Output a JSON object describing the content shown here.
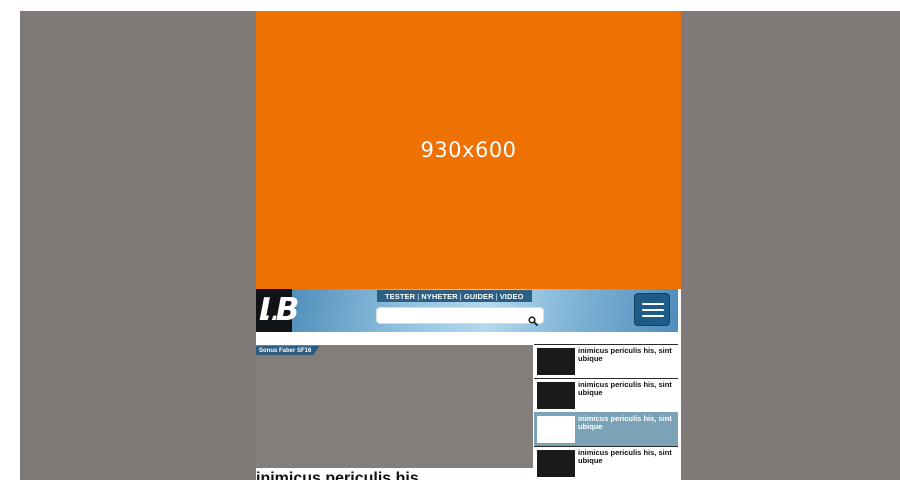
{
  "ad": {
    "label": "930x600",
    "color": "#ee7203"
  },
  "header": {
    "logo_text": "LB",
    "nav": [
      {
        "label": "TESTER"
      },
      {
        "label": "NYHETER"
      },
      {
        "label": "GUIDER"
      },
      {
        "label": "VIDEO"
      }
    ],
    "nav_separator": "|",
    "search": {
      "placeholder": "",
      "value": ""
    },
    "icons": {
      "search": "search-icon",
      "menu": "hamburger-menu-icon"
    }
  },
  "featured": {
    "tag": "Sonus Faber SF16",
    "headline": "inimicus periculis his,"
  },
  "sidebar": {
    "items": [
      {
        "text": "inimicus periculis his, sint ubique",
        "active": false
      },
      {
        "text": "inimicus periculis his, sint ubique",
        "active": false
      },
      {
        "text": "inimicus periculis his, sint ubique",
        "active": true
      },
      {
        "text": "inimicus periculis his, sint ubique",
        "active": false
      }
    ]
  },
  "colors": {
    "backdrop": "#7f7a77",
    "accent_blue": "#1e5b87",
    "active_item": "#7aa3b8"
  }
}
